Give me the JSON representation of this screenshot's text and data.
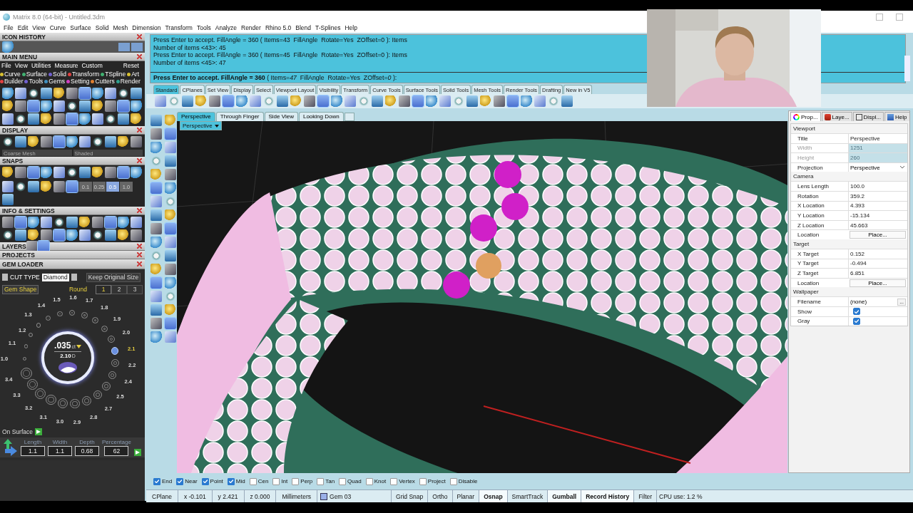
{
  "window": {
    "title": "Matrix 8.0 (64-bit) - Untitled.3dm"
  },
  "menu": [
    "File",
    "Edit",
    "View",
    "Curve",
    "Surface",
    "Solid",
    "Mesh",
    "Dimension",
    "Transform",
    "Tools",
    "Analyze",
    "Render",
    "Rhino 5.0",
    "Blend",
    "T-Splines",
    "Help"
  ],
  "left_panel": {
    "icon_history": {
      "title": "ICON HISTORY"
    },
    "main_menu": {
      "title": "MAIN MENU",
      "menu": [
        "File",
        "View",
        "Utilities",
        "Measure",
        "Custom"
      ],
      "reset": "Reset",
      "categories": [
        {
          "label": "Curve",
          "color": "#d8c030"
        },
        {
          "label": "Surface",
          "color": "#40b070"
        },
        {
          "label": "Solid",
          "color": "#7060d0"
        },
        {
          "label": "Transform",
          "color": "#e04040"
        },
        {
          "label": "TSpline",
          "color": "#40b070"
        },
        {
          "label": "Art",
          "color": "#d8c030"
        },
        {
          "label": "Builder",
          "color": "#e04040"
        },
        {
          "label": "Tools",
          "color": "#7060d0"
        },
        {
          "label": "Gems",
          "color": "#4090c0"
        },
        {
          "label": "Setting",
          "color": "#d040c0"
        },
        {
          "label": "Cutters",
          "color": "#e08030"
        },
        {
          "label": "Render",
          "color": "#30a090"
        }
      ]
    },
    "display": {
      "title": "DISPLAY",
      "mesh": "Coarse Mesh",
      "shading": "Shaded"
    },
    "snaps": {
      "title": "SNAPS",
      "steps": [
        {
          "label": "0.1",
          "selected": false
        },
        {
          "label": "0.25",
          "selected": false
        },
        {
          "label": "0.5",
          "selected": true
        },
        {
          "label": "1.0",
          "selected": false
        }
      ]
    },
    "info_settings": {
      "title": "INFO & SETTINGS"
    },
    "layers": {
      "title": "LAYERS"
    },
    "projects": {
      "title": "PROJECTS"
    },
    "gem_loader": {
      "title": "GEM LOADER",
      "cut_type_label": "CUT TYPE",
      "cut_type": "Diamond",
      "keep_size": "Keep Original Size",
      "gem_shape": "Gem Shape",
      "shape": "Round",
      "pages": [
        {
          "label": "1",
          "selected": true
        },
        {
          "label": "2",
          "selected": false
        },
        {
          "label": "3",
          "selected": false
        }
      ],
      "sizes": [
        {
          "label": "1.0",
          "selected": false
        },
        {
          "label": "1.1",
          "selected": false
        },
        {
          "label": "1.2",
          "selected": false
        },
        {
          "label": "1.3",
          "selected": false
        },
        {
          "label": "1.4",
          "selected": false
        },
        {
          "label": "1.5",
          "selected": false
        },
        {
          "label": "1.6",
          "selected": false
        },
        {
          "label": "1.7",
          "selected": false
        },
        {
          "label": "1.8",
          "selected": false
        },
        {
          "label": "1.9",
          "selected": false
        },
        {
          "label": "2.0",
          "selected": false
        },
        {
          "label": "2.1",
          "selected": true
        },
        {
          "label": "2.2",
          "selected": false
        },
        {
          "label": "2.4",
          "selected": false
        },
        {
          "label": "2.5",
          "selected": false
        },
        {
          "label": "2.7",
          "selected": false
        },
        {
          "label": "2.8",
          "selected": false
        },
        {
          "label": "2.9",
          "selected": false
        },
        {
          "label": "3.0",
          "selected": false
        },
        {
          "label": "3.1",
          "selected": false
        },
        {
          "label": "3.2",
          "selected": false
        },
        {
          "label": "3.3",
          "selected": false
        },
        {
          "label": "3.4",
          "selected": false
        }
      ],
      "carat": ".035",
      "carat_unit": "ct",
      "diameter": "2.10",
      "diameter_unit": "D",
      "on_surface": "On Surface",
      "fields": [
        {
          "label": "Length",
          "value": "1.1"
        },
        {
          "label": "Width",
          "value": "1.1"
        },
        {
          "label": "Depth",
          "value": "0.68"
        },
        {
          "label": "Percentage",
          "value": "62"
        }
      ]
    }
  },
  "command": {
    "history": [
      "Press Enter to accept. FillAngle = 360 ( Items=43  FillAngle  Rotate=Yes  ZOffset=0 ): Items",
      "Number of items <43>: 45",
      "Press Enter to accept. FillAngle = 360 ( Items=45  FillAngle  Rotate=Yes  ZOffset=0 ): Items",
      "Number of items <45>: 47"
    ],
    "prompt": "**Press Enter to accept. FillAngle = 360** ( Items=*47*  FillAngle  Rotate=Yes  ZOffset=*0* ):"
  },
  "toolbar_tabs": [
    {
      "label": "Standard",
      "selected": true
    },
    {
      "label": "CPlanes",
      "selected": false
    },
    {
      "label": "Set View",
      "selected": false
    },
    {
      "label": "Display",
      "selected": false
    },
    {
      "label": "Select",
      "selected": false
    },
    {
      "label": "Viewport Layout",
      "selected": false
    },
    {
      "label": "Visibility",
      "selected": false
    },
    {
      "label": "Transform",
      "selected": false
    },
    {
      "label": "Curve Tools",
      "selected": false
    },
    {
      "label": "Surface Tools",
      "selected": false
    },
    {
      "label": "Solid Tools",
      "selected": false
    },
    {
      "label": "Mesh Tools",
      "selected": false
    },
    {
      "label": "Render Tools",
      "selected": false
    },
    {
      "label": "Drafting",
      "selected": false
    },
    {
      "label": "New in V5",
      "selected": false
    }
  ],
  "viewport_tabs": [
    {
      "label": "Perspective",
      "selected": true
    },
    {
      "label": "Through Finger",
      "selected": false
    },
    {
      "label": "Side View",
      "selected": false
    },
    {
      "label": "Looking Down",
      "selected": false
    }
  ],
  "viewport": {
    "label": "Perspective"
  },
  "properties": {
    "tabs": [
      {
        "label": "Prop...",
        "selected": true
      },
      {
        "label": "Laye...",
        "selected": false
      },
      {
        "label": "Displ...",
        "selected": false
      },
      {
        "label": "Help",
        "selected": false
      }
    ],
    "sections": [
      {
        "title": "Viewport",
        "rows": [
          {
            "label": "Title",
            "value": "Perspective",
            "kind": "text",
            "disabled": false
          },
          {
            "label": "Width",
            "value": "1251",
            "kind": "text",
            "disabled": true
          },
          {
            "label": "Height",
            "value": "260",
            "kind": "text",
            "disabled": true
          },
          {
            "label": "Projection",
            "value": "Perspective",
            "kind": "dropdown",
            "disabled": false
          }
        ]
      },
      {
        "title": "Camera",
        "rows": [
          {
            "label": "Lens Length",
            "value": "100.0",
            "kind": "text",
            "disabled": false
          },
          {
            "label": "Rotation",
            "value": "359.2",
            "kind": "text",
            "disabled": false
          },
          {
            "label": "X Location",
            "value": "4.393",
            "kind": "text",
            "disabled": false
          },
          {
            "label": "Y Location",
            "value": "-15.134",
            "kind": "text",
            "disabled": false
          },
          {
            "label": "Z Location",
            "value": "45.663",
            "kind": "text",
            "disabled": false
          },
          {
            "label": "Location",
            "value": "Place...",
            "kind": "button",
            "disabled": false
          }
        ]
      },
      {
        "title": "Target",
        "rows": [
          {
            "label": "X Target",
            "value": "0.152",
            "kind": "text",
            "disabled": false
          },
          {
            "label": "Y Target",
            "value": "-0.494",
            "kind": "text",
            "disabled": false
          },
          {
            "label": "Z Target",
            "value": "6.851",
            "kind": "text",
            "disabled": false
          },
          {
            "label": "Location",
            "value": "Place...",
            "kind": "button",
            "disabled": false
          }
        ]
      },
      {
        "title": "Wallpaper",
        "rows": [
          {
            "label": "Filename",
            "value": "(none)",
            "browse": "...",
            "kind": "file",
            "disabled": false
          },
          {
            "label": "Show",
            "checked": true,
            "kind": "checkbox",
            "disabled": false
          },
          {
            "label": "Gray",
            "checked": true,
            "kind": "checkbox",
            "disabled": false
          }
        ]
      }
    ]
  },
  "osnaps": [
    {
      "label": "End",
      "checked": true
    },
    {
      "label": "Near",
      "checked": true
    },
    {
      "label": "Point",
      "checked": true
    },
    {
      "label": "Mid",
      "checked": true
    },
    {
      "label": "Cen",
      "checked": false
    },
    {
      "label": "Int",
      "checked": false
    },
    {
      "label": "Perp",
      "checked": false
    },
    {
      "label": "Tan",
      "checked": false
    },
    {
      "label": "Quad",
      "checked": false
    },
    {
      "label": "Knot",
      "checked": false
    },
    {
      "label": "Vertex",
      "checked": false
    },
    {
      "label": "Project",
      "checked": false
    },
    {
      "label": "Disable",
      "checked": false
    }
  ],
  "status_bar": {
    "cells": [
      "CPlane",
      "x -0.101",
      "y 2.421",
      "z 0.000",
      "Millimeters"
    ],
    "layer": "Gem 03",
    "toggles": [
      {
        "label": "Grid Snap",
        "on": false
      },
      {
        "label": "Ortho",
        "on": false
      },
      {
        "label": "Planar",
        "on": false
      },
      {
        "label": "Osnap",
        "on": true
      },
      {
        "label": "SmartTrack",
        "on": false
      },
      {
        "label": "Gumball",
        "on": true
      },
      {
        "label": "Record History",
        "on": true
      },
      {
        "label": "Filter",
        "on": false
      }
    ],
    "cpu": "CPU use: 1.2 %"
  }
}
